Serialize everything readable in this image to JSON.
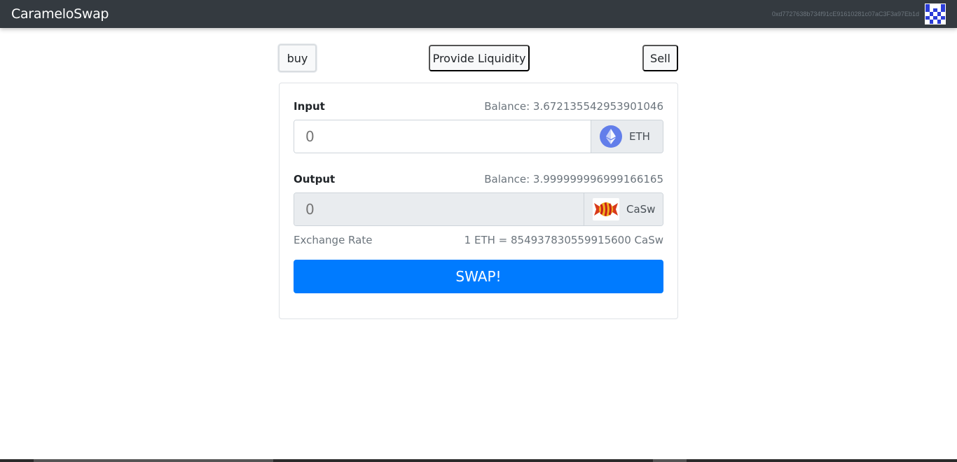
{
  "navbar": {
    "brand": "CarameloSwap",
    "address": "0xd7727638b734f91cE91610281c07aC3F3a97Eb1d",
    "identicon": [
      1,
      0,
      0,
      0,
      1,
      1,
      0,
      1,
      0,
      1,
      0,
      1,
      0,
      1,
      0,
      1,
      0,
      1,
      0,
      1,
      0,
      1,
      0,
      1,
      0
    ]
  },
  "tabs": {
    "buy": "buy",
    "liquidity": "Provide Liquidity",
    "sell": "Sell"
  },
  "input": {
    "label": "Input",
    "balance": "Balance: 3.672135542953901046",
    "placeholder": "0",
    "token": "ETH",
    "token_icon": "ethereum-icon"
  },
  "output": {
    "label": "Output",
    "balance": "Balance: 3.999999996999166165",
    "placeholder": "0",
    "token": "CaSw",
    "token_icon": "candy-icon"
  },
  "rate": {
    "label": "Exchange Rate",
    "value": "1 ETH = 854937830559915600 CaSw"
  },
  "swap": {
    "label": "SWAP!"
  },
  "colors": {
    "navbar": "#343a40",
    "primary": "#007bff",
    "eth": "#627eea"
  }
}
